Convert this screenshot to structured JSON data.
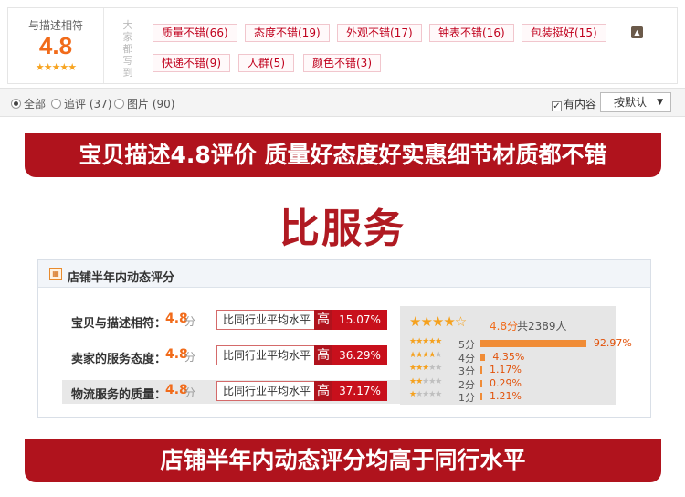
{
  "rating_summary": {
    "label": "与描述相符",
    "score": "4.8",
    "stars": "★★★★★",
    "vertical_label": "大家都写到",
    "tags": [
      {
        "label": "质量不错(66)"
      },
      {
        "label": "态度不错(19)"
      },
      {
        "label": "外观不错(17)"
      },
      {
        "label": "钟表不错(16)"
      },
      {
        "label": "包装挺好(15)"
      },
      {
        "label": "快递不错(9)"
      },
      {
        "label": "人群(5)"
      },
      {
        "label": "颜色不错(3)"
      }
    ],
    "expand_icon": "chevron-up-icon"
  },
  "filter": {
    "options": [
      {
        "label": "全部",
        "selected": true
      },
      {
        "label": "追评 (37)",
        "selected": false
      },
      {
        "label": "图片 (90)",
        "selected": false
      }
    ],
    "has_content_label": "有内容",
    "has_content_checked": true,
    "sort_label": "按默认"
  },
  "banners": {
    "top": "宝贝描述4.8评价 质量好态度好实惠细节材质都不错",
    "headline": "比服务",
    "bottom": "店铺半年内动态评分均高于同行水平"
  },
  "dsr": {
    "title": "店铺半年内动态评分",
    "unit": "分",
    "compare_label": "比同行业平均水平",
    "high_label": "高",
    "rows": [
      {
        "label": "宝贝与描述相符：",
        "score": "4.8",
        "pct": "15.07%"
      },
      {
        "label": "卖家的服务态度：",
        "score": "4.8",
        "pct": "36.29%"
      },
      {
        "label": "物流服务的质量：",
        "score": "4.8",
        "pct": "37.17%"
      }
    ],
    "distribution": {
      "stars": "★★★★☆",
      "score": "4.8分",
      "total": "共2389人",
      "levels": [
        {
          "label": "5分",
          "pct": "92.97%",
          "value": 92.97,
          "stars": 5
        },
        {
          "label": "4分",
          "pct": "4.35%",
          "value": 4.35,
          "stars": 4
        },
        {
          "label": "3分",
          "pct": "1.17%",
          "value": 1.17,
          "stars": 3
        },
        {
          "label": "2分",
          "pct": "0.29%",
          "value": 0.29,
          "stars": 2
        },
        {
          "label": "1分",
          "pct": "1.21%",
          "value": 1.21,
          "stars": 1
        }
      ]
    }
  }
}
